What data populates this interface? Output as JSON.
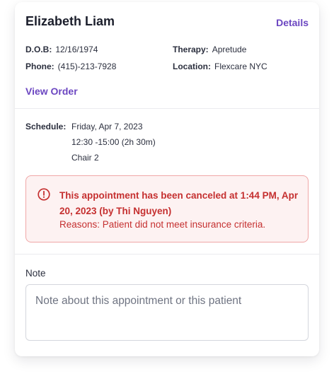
{
  "patient": {
    "name": "Elizabeth Liam",
    "details_link": "Details",
    "dob_label": "D.O.B:",
    "dob_value": "12/16/1974",
    "phone_label": "Phone:",
    "phone_value": "(415)-213-7928",
    "therapy_label": "Therapy:",
    "therapy_value": "Apretude",
    "location_label": "Location:",
    "location_value": "Flexcare NYC",
    "view_order": "View Order"
  },
  "schedule": {
    "label": "Schedule:",
    "date": "Friday, Apr 7, 2023",
    "time": "12:30 -15:00 (2h 30m)",
    "chair": "Chair 2"
  },
  "alert": {
    "icon": "alert-circle-icon",
    "title": "This appointment has been canceled at 1:44 PM, Apr 20, 2023 (by Thi Nguyen)",
    "reason": "Reasons: Patient did not meet insurance criteria.",
    "text_color": "#c53030",
    "background": "#fdf2f2",
    "border": "#f0a7a7"
  },
  "note": {
    "label": "Note",
    "placeholder": "Note about this appointment or this patient",
    "value": ""
  },
  "colors": {
    "accent": "#6b46c1",
    "text": "#1f2433"
  }
}
